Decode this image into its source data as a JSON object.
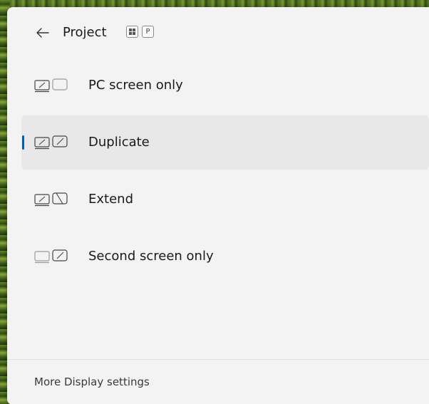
{
  "panel": {
    "title": "Project",
    "back_icon": "arrow-left-icon",
    "shortcut_keys": [
      "windows-key-icon",
      "P"
    ]
  },
  "options": [
    {
      "label": "PC screen only",
      "icon": "pc-screen-only-icon",
      "selected": false
    },
    {
      "label": "Duplicate",
      "icon": "duplicate-icon",
      "selected": true
    },
    {
      "label": "Extend",
      "icon": "extend-icon",
      "selected": false
    },
    {
      "label": "Second screen only",
      "icon": "second-screen-only-icon",
      "selected": false
    }
  ],
  "footer": {
    "link_label": "More Display settings"
  },
  "colors": {
    "panel_bg": "#f3f3f3",
    "selected_bg": "#e8e8e8",
    "accent": "#005fb8",
    "text": "#1a1a1a"
  }
}
